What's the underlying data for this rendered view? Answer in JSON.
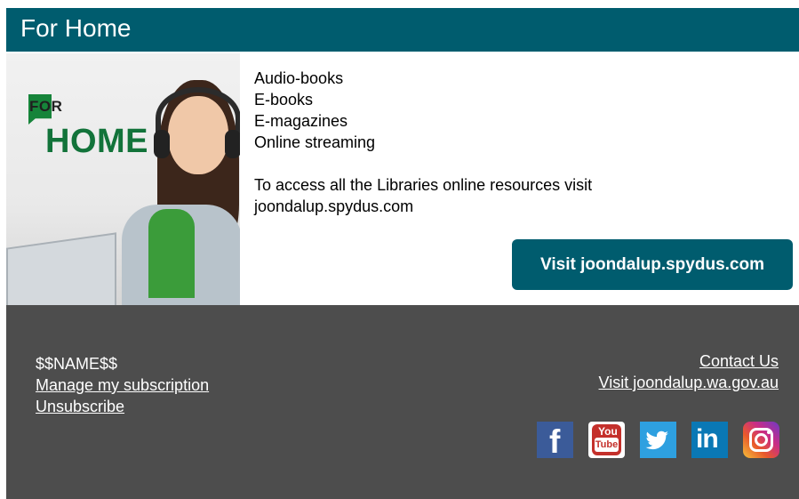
{
  "header": {
    "title": "For Home"
  },
  "promo": {
    "image": {
      "logo_for": "FOR",
      "logo_home": "HOME"
    },
    "list": [
      "Audio-books",
      "E-books",
      "E-magazines",
      "Online streaming"
    ],
    "access_text": "To access all the Libraries online resources visit joondalup.spydus.com",
    "visit_button": "Visit joondalup.spydus.com"
  },
  "footer": {
    "name_placeholder": "$$NAME$$",
    "manage_subscription": "Manage my subscription",
    "unsubscribe": "Unsubscribe",
    "contact_us": "Contact Us",
    "visit_site": "Visit joondalup.wa.gov.au",
    "social": {
      "facebook_glyph": "f",
      "youtube_top": "You",
      "youtube_bottom": "Tube",
      "linkedin_glyph": "in"
    }
  },
  "colors": {
    "header_bg": "#005c6e",
    "button_bg": "#005c6e",
    "footer_bg": "#4d4d4d"
  },
  "icons": [
    "facebook-icon",
    "youtube-icon",
    "twitter-icon",
    "linkedin-icon",
    "instagram-icon"
  ]
}
